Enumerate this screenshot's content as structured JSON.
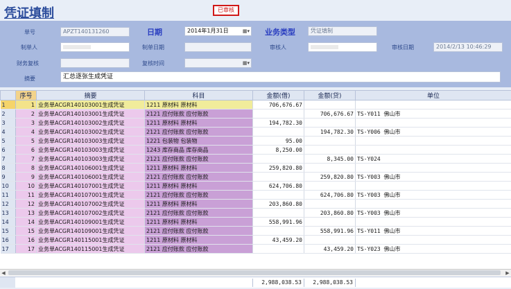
{
  "title": "凭证填制",
  "status": "已审核",
  "form": {
    "voucher_no_label": "单号",
    "voucher_no": "APZT140131260",
    "date_label": "日期",
    "date_value": "2014年1月31日",
    "biz_type_label": "业务类型",
    "biz_type_value": "凭证填制",
    "maker_label": "制单人",
    "maker_value": "",
    "make_date_label": "制单日期",
    "make_date_value": "",
    "auditor_label": "审核人",
    "auditor_value": "",
    "audit_date_label": "审核日期",
    "audit_date_value": "2014/2/13 10:46:29",
    "finance_review_label": "财务复核",
    "finance_review_value": "",
    "review_time_label": "复核时间",
    "review_time_value": "",
    "summary_label": "摘要",
    "summary_value": "汇总逐张生成凭证"
  },
  "grid": {
    "headers": [
      "序号",
      "摘要",
      "科目",
      "金额(借)",
      "金额(贷)",
      "单位"
    ],
    "rows": [
      {
        "rn": "1",
        "seq": "1",
        "desc": "业务单ACGR140103001生成凭证",
        "subject": "1211 原材料  原材料",
        "debit": "706,676.67",
        "credit": "",
        "unit": ""
      },
      {
        "rn": "2",
        "seq": "2",
        "desc": "业务单ACGR140103001生成凭证",
        "subject": "2121 应付账款  应付账款",
        "debit": "",
        "credit": "706,676.67",
        "unit": "TS-Y011  佛山市"
      },
      {
        "rn": "3",
        "seq": "3",
        "desc": "业务单ACGR140103002生成凭证",
        "subject": "1211 原材料  原材料",
        "debit": "194,782.30",
        "credit": "",
        "unit": ""
      },
      {
        "rn": "4",
        "seq": "4",
        "desc": "业务单ACGR140103002生成凭证",
        "subject": "2121 应付账款  应付账款",
        "debit": "",
        "credit": "194,782.30",
        "unit": "TS-Y006  佛山市"
      },
      {
        "rn": "5",
        "seq": "5",
        "desc": "业务单ACGR140103003生成凭证",
        "subject": "1221 包装物  包装物",
        "debit": "95.00",
        "credit": "",
        "unit": ""
      },
      {
        "rn": "6",
        "seq": "6",
        "desc": "业务单ACGR140103003生成凭证",
        "subject": "1243 库存商品  库存商品",
        "debit": "8,250.00",
        "credit": "",
        "unit": ""
      },
      {
        "rn": "7",
        "seq": "7",
        "desc": "业务单ACGR140103003生成凭证",
        "subject": "2121 应付账款  应付账款",
        "debit": "",
        "credit": "8,345.00",
        "unit": "TS-Y024"
      },
      {
        "rn": "8",
        "seq": "8",
        "desc": "业务单ACGR140106001生成凭证",
        "subject": "1211 原材料  原材料",
        "debit": "259,820.80",
        "credit": "",
        "unit": ""
      },
      {
        "rn": "9",
        "seq": "9",
        "desc": "业务单ACGR140106001生成凭证",
        "subject": "2121 应付账款  应付账款",
        "debit": "",
        "credit": "259,820.80",
        "unit": "TS-Y003  佛山市"
      },
      {
        "rn": "10",
        "seq": "10",
        "desc": "业务单ACGR140107001生成凭证",
        "subject": "1211 原材料  原材料",
        "debit": "624,706.80",
        "credit": "",
        "unit": ""
      },
      {
        "rn": "11",
        "seq": "11",
        "desc": "业务单ACGR140107001生成凭证",
        "subject": "2121 应付账款  应付账款",
        "debit": "",
        "credit": "624,706.80",
        "unit": "TS-Y003  佛山市"
      },
      {
        "rn": "12",
        "seq": "12",
        "desc": "业务单ACGR140107002生成凭证",
        "subject": "1211 原材料  原材料",
        "debit": "203,860.80",
        "credit": "",
        "unit": ""
      },
      {
        "rn": "13",
        "seq": "13",
        "desc": "业务单ACGR140107002生成凭证",
        "subject": "2121 应付账款  应付账款",
        "debit": "",
        "credit": "203,860.80",
        "unit": "TS-Y003  佛山市"
      },
      {
        "rn": "14",
        "seq": "14",
        "desc": "业务单ACGR140109001生成凭证",
        "subject": "1211 原材料  原材料",
        "debit": "558,991.96",
        "credit": "",
        "unit": ""
      },
      {
        "rn": "15",
        "seq": "15",
        "desc": "业务单ACGR140109001生成凭证",
        "subject": "2121 应付账款  应付账款",
        "debit": "",
        "credit": "558,991.96",
        "unit": "TS-Y011  佛山市"
      },
      {
        "rn": "16",
        "seq": "16",
        "desc": "业务单ACGR140115001生成凭证",
        "subject": "1211 原材料  原材料",
        "debit": "43,459.20",
        "credit": "",
        "unit": ""
      },
      {
        "rn": "17",
        "seq": "17",
        "desc": "业务单ACGR140115001生成凭证",
        "subject": "2121 应付账款  应付账款",
        "debit": "",
        "credit": "43,459.20",
        "unit": "TS-Y023  佛山市"
      }
    ],
    "total_debit": "2,988,038.53",
    "total_credit": "2,988,038.53"
  }
}
